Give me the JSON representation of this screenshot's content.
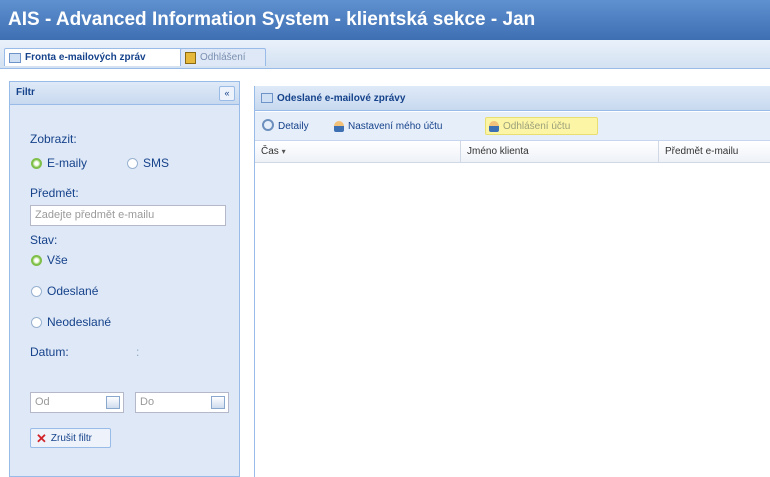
{
  "app": {
    "title": "AIS - Advanced Information System - klientská sekce - Jan"
  },
  "tabs": [
    {
      "label": "Fronta e-mailových zpráv",
      "icon": "mail-icon",
      "active": true
    },
    {
      "label": "Odhlášení",
      "icon": "logout-icon",
      "active": false
    }
  ],
  "filter": {
    "title": "Filtr",
    "collapse_icon": "«",
    "show_label": "Zobrazit:",
    "show_options": [
      {
        "label": "E-maily",
        "checked": true
      },
      {
        "label": "SMS",
        "checked": false
      }
    ],
    "subject_label": "Předmět:",
    "subject_placeholder": "Zadejte předmět e-mailu",
    "state_label": "Stav:",
    "state_options": [
      {
        "label": "Vše",
        "checked": true
      },
      {
        "label": "Odeslané",
        "checked": false
      },
      {
        "label": "Neodeslané",
        "checked": false
      }
    ],
    "date_label": "Datum:",
    "date_separator": ":",
    "date_from_placeholder": "Od",
    "date_to_placeholder": "Do",
    "clear_button": "Zrušit filtr"
  },
  "sent": {
    "title": "Odeslané e-mailové zprávy",
    "toolbar": {
      "details": "Detaily",
      "account_settings": "Nastavení mého účtu",
      "logout_account": "Odhlášení účtu"
    },
    "columns": [
      "Čas",
      "Jméno klienta",
      "Předmět e-mailu"
    ],
    "sort_indicator": "▾"
  },
  "colors": {
    "titlebar": "#4a7bbf",
    "panel_bg": "#dfe8f6",
    "border": "#99bbe8",
    "text": "#15428b",
    "highlight": "#fdf5a6",
    "radio_checked": "#7fbf4a",
    "clear_icon": "#d2242b"
  }
}
